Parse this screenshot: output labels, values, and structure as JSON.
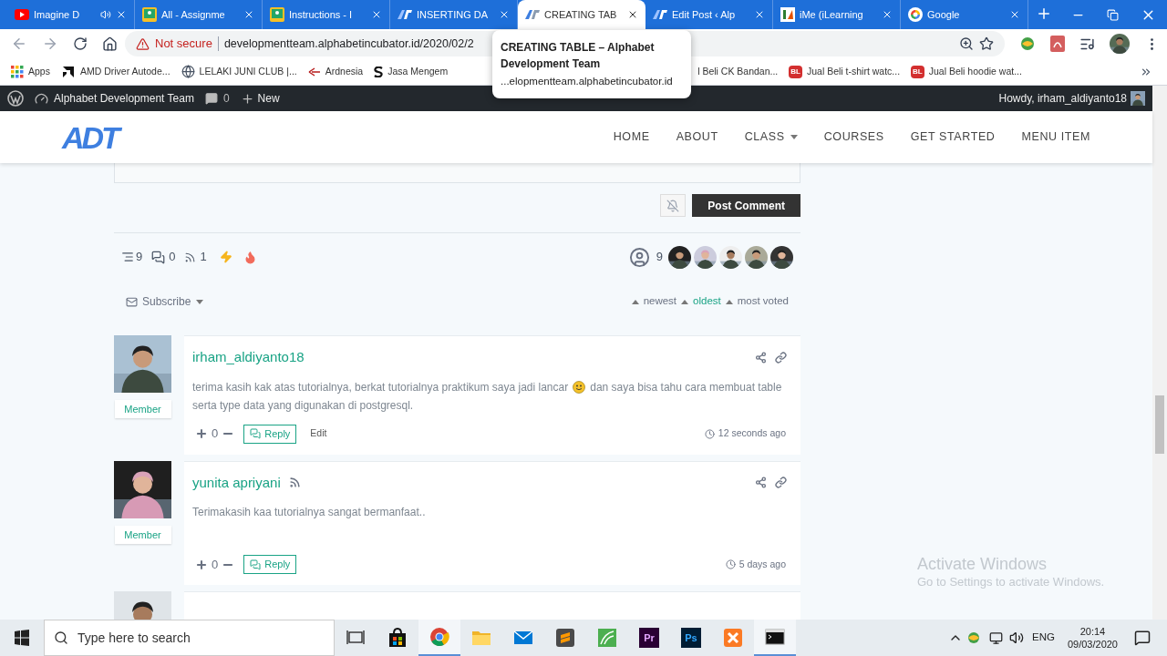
{
  "browser": {
    "tabs": [
      {
        "title": "Imagine D",
        "kind": "youtube",
        "audio": true,
        "selected": false
      },
      {
        "title": "All - Assignme",
        "kind": "classroom",
        "audio": false,
        "selected": false
      },
      {
        "title": "Instructions - I",
        "kind": "classroom",
        "audio": false,
        "selected": false
      },
      {
        "title": "INSERTING DA",
        "kind": "adt",
        "audio": false,
        "selected": false
      },
      {
        "title": "CREATING TAB",
        "kind": "adt",
        "audio": false,
        "selected": true
      },
      {
        "title": "Edit Post ‹ Alp",
        "kind": "adt",
        "audio": false,
        "selected": false
      },
      {
        "title": "iMe (iLearning",
        "kind": "ime",
        "audio": false,
        "selected": false
      },
      {
        "title": "Google",
        "kind": "google",
        "audio": false,
        "selected": false
      }
    ],
    "tooltip": {
      "title": "CREATING TABLE – Alphabet Development Team",
      "url": "...elopmentteam.alphabetincubator.id"
    },
    "address": {
      "security": "Not secure",
      "url": "developmentteam.alphabetincubator.id/2020/02/2"
    },
    "bookmarks": [
      {
        "label": "Apps",
        "kind": "apps"
      },
      {
        "label": "AMD Driver Autode...",
        "kind": "amd"
      },
      {
        "label": "LELAKI JUNI CLUB |...",
        "kind": "globe"
      },
      {
        "label": "Ardnesia",
        "kind": "ardnesia"
      },
      {
        "label": "Jasa Mengem",
        "kind": "dot"
      },
      {
        "label": "l Beli CK Bandan...",
        "kind": "hidden"
      },
      {
        "label": "Jual Beli t-shirt watc...",
        "kind": "bl",
        "badge": "BL"
      },
      {
        "label": "Jual Beli hoodie wat...",
        "kind": "bl",
        "badge": "BL"
      }
    ]
  },
  "admin_bar": {
    "site": "Alphabet Development Team",
    "comments": "0",
    "new": "New",
    "howdy": "Howdy, irham_aldiyanto18"
  },
  "site_header": {
    "logo": "ADT",
    "nav": [
      {
        "label": "HOME",
        "dropdown": false
      },
      {
        "label": "ABOUT",
        "dropdown": false
      },
      {
        "label": "CLASS",
        "dropdown": true
      },
      {
        "label": "COURSES",
        "dropdown": false
      },
      {
        "label": "GET STARTED",
        "dropdown": false
      },
      {
        "label": "MENU ITEM",
        "dropdown": false
      }
    ]
  },
  "comment_form": {
    "submit": "Post Comment"
  },
  "stats": {
    "threads": "9",
    "replies": "0",
    "followers": "1",
    "participants": "9"
  },
  "subscribe": "Subscribe",
  "sort": [
    {
      "label": "newest",
      "selected": false
    },
    {
      "label": "oldest",
      "selected": true
    },
    {
      "label": "most voted",
      "selected": false
    }
  ],
  "comments": [
    {
      "author": "irham_aldiyanto18",
      "feed": false,
      "role": "Member",
      "text_lines": [
        [
          "terima kasih kak atas tutorialnya, berkat tutorialnya praktikum saya jadi lancar",
          "dan saya bisa tahu cara membuat table"
        ],
        [
          "serta type data yang digunakan di postgresql."
        ]
      ],
      "votes": "0",
      "reply": "Reply",
      "edit": "Edit",
      "time": "12 seconds ago"
    },
    {
      "author": "yunita apriyani",
      "feed": true,
      "role": "Member",
      "text_lines": [
        [
          "Terimakasih kaa tutorialnya sangat bermanfaat.."
        ]
      ],
      "votes": "0",
      "reply": "Reply",
      "time": "5 days ago"
    }
  ],
  "more_comments_below": true,
  "activation_notice": {
    "title": "Activate Windows",
    "text": "Go to Settings to activate Windows."
  },
  "taskbar": {
    "search_placeholder": "Type here to search",
    "apps": [
      {
        "kind": "store",
        "running": false
      },
      {
        "kind": "chrome",
        "running": true
      },
      {
        "kind": "explorer",
        "running": false
      },
      {
        "kind": "mail",
        "running": false
      },
      {
        "kind": "sublime",
        "running": false
      },
      {
        "kind": "sheet",
        "running": false
      },
      {
        "kind": "premiere",
        "label": "Pr",
        "running": false
      },
      {
        "kind": "photoshop",
        "label": "Ps",
        "running": false
      },
      {
        "kind": "xampp",
        "running": false
      },
      {
        "kind": "terminal",
        "running": true
      }
    ],
    "language": "ENG",
    "time": "20:14",
    "date": "09/03/2020"
  }
}
